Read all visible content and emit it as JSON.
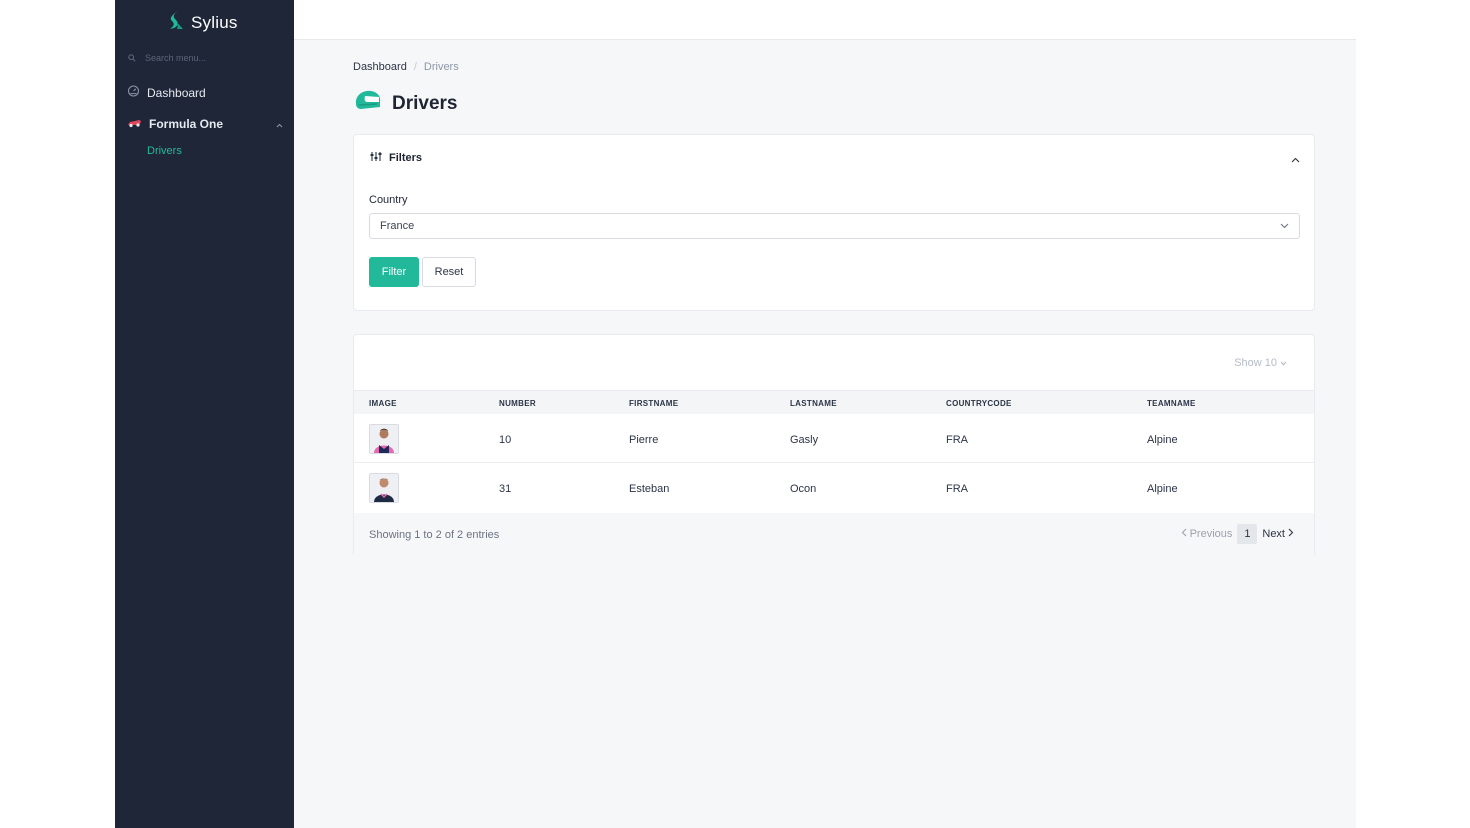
{
  "app": {
    "name": "Sylius",
    "brand_color": "#22b99a"
  },
  "sidebar": {
    "search_placeholder": "Search menu...",
    "items": [
      {
        "label": "Dashboard",
        "icon": "dashboard-icon"
      },
      {
        "label": "Formula One",
        "icon": "race-car-icon",
        "expanded": true,
        "children": [
          {
            "label": "Drivers",
            "active": true
          }
        ]
      }
    ]
  },
  "breadcrumb": {
    "root": "Dashboard",
    "separator": "/",
    "current": "Drivers"
  },
  "page": {
    "title": "Drivers",
    "icon": "helmet-icon"
  },
  "filters": {
    "title": "Filters",
    "country_label": "Country",
    "country_value": "France",
    "filter_button": "Filter",
    "reset_button": "Reset"
  },
  "table": {
    "show_label": "Show 10",
    "columns": [
      "IMAGE",
      "NUMBER",
      "FIRSTNAME",
      "LASTNAME",
      "COUNTRYCODE",
      "TEAMNAME"
    ],
    "rows": [
      {
        "number": "10",
        "firstname": "Pierre",
        "lastname": "Gasly",
        "countrycode": "FRA",
        "teamname": "Alpine"
      },
      {
        "number": "31",
        "firstname": "Esteban",
        "lastname": "Ocon",
        "countrycode": "FRA",
        "teamname": "Alpine"
      }
    ],
    "showing": "Showing 1 to 2 of 2 entries",
    "pagination": {
      "previous": "Previous",
      "current": "1",
      "next": "Next"
    }
  }
}
